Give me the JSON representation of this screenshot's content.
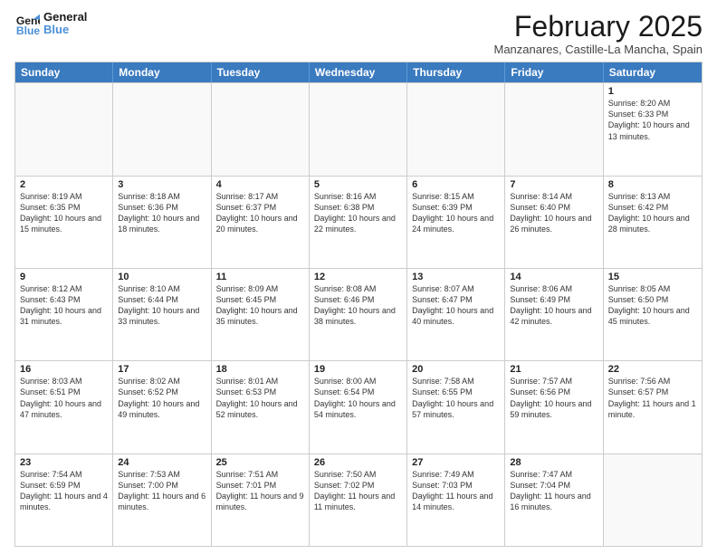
{
  "header": {
    "logo_line1": "General",
    "logo_line2": "Blue",
    "month_title": "February 2025",
    "location": "Manzanares, Castille-La Mancha, Spain"
  },
  "weekdays": [
    "Sunday",
    "Monday",
    "Tuesday",
    "Wednesday",
    "Thursday",
    "Friday",
    "Saturday"
  ],
  "weeks": [
    [
      {
        "day": "",
        "info": ""
      },
      {
        "day": "",
        "info": ""
      },
      {
        "day": "",
        "info": ""
      },
      {
        "day": "",
        "info": ""
      },
      {
        "day": "",
        "info": ""
      },
      {
        "day": "",
        "info": ""
      },
      {
        "day": "1",
        "info": "Sunrise: 8:20 AM\nSunset: 6:33 PM\nDaylight: 10 hours and 13 minutes."
      }
    ],
    [
      {
        "day": "2",
        "info": "Sunrise: 8:19 AM\nSunset: 6:35 PM\nDaylight: 10 hours and 15 minutes."
      },
      {
        "day": "3",
        "info": "Sunrise: 8:18 AM\nSunset: 6:36 PM\nDaylight: 10 hours and 18 minutes."
      },
      {
        "day": "4",
        "info": "Sunrise: 8:17 AM\nSunset: 6:37 PM\nDaylight: 10 hours and 20 minutes."
      },
      {
        "day": "5",
        "info": "Sunrise: 8:16 AM\nSunset: 6:38 PM\nDaylight: 10 hours and 22 minutes."
      },
      {
        "day": "6",
        "info": "Sunrise: 8:15 AM\nSunset: 6:39 PM\nDaylight: 10 hours and 24 minutes."
      },
      {
        "day": "7",
        "info": "Sunrise: 8:14 AM\nSunset: 6:40 PM\nDaylight: 10 hours and 26 minutes."
      },
      {
        "day": "8",
        "info": "Sunrise: 8:13 AM\nSunset: 6:42 PM\nDaylight: 10 hours and 28 minutes."
      }
    ],
    [
      {
        "day": "9",
        "info": "Sunrise: 8:12 AM\nSunset: 6:43 PM\nDaylight: 10 hours and 31 minutes."
      },
      {
        "day": "10",
        "info": "Sunrise: 8:10 AM\nSunset: 6:44 PM\nDaylight: 10 hours and 33 minutes."
      },
      {
        "day": "11",
        "info": "Sunrise: 8:09 AM\nSunset: 6:45 PM\nDaylight: 10 hours and 35 minutes."
      },
      {
        "day": "12",
        "info": "Sunrise: 8:08 AM\nSunset: 6:46 PM\nDaylight: 10 hours and 38 minutes."
      },
      {
        "day": "13",
        "info": "Sunrise: 8:07 AM\nSunset: 6:47 PM\nDaylight: 10 hours and 40 minutes."
      },
      {
        "day": "14",
        "info": "Sunrise: 8:06 AM\nSunset: 6:49 PM\nDaylight: 10 hours and 42 minutes."
      },
      {
        "day": "15",
        "info": "Sunrise: 8:05 AM\nSunset: 6:50 PM\nDaylight: 10 hours and 45 minutes."
      }
    ],
    [
      {
        "day": "16",
        "info": "Sunrise: 8:03 AM\nSunset: 6:51 PM\nDaylight: 10 hours and 47 minutes."
      },
      {
        "day": "17",
        "info": "Sunrise: 8:02 AM\nSunset: 6:52 PM\nDaylight: 10 hours and 49 minutes."
      },
      {
        "day": "18",
        "info": "Sunrise: 8:01 AM\nSunset: 6:53 PM\nDaylight: 10 hours and 52 minutes."
      },
      {
        "day": "19",
        "info": "Sunrise: 8:00 AM\nSunset: 6:54 PM\nDaylight: 10 hours and 54 minutes."
      },
      {
        "day": "20",
        "info": "Sunrise: 7:58 AM\nSunset: 6:55 PM\nDaylight: 10 hours and 57 minutes."
      },
      {
        "day": "21",
        "info": "Sunrise: 7:57 AM\nSunset: 6:56 PM\nDaylight: 10 hours and 59 minutes."
      },
      {
        "day": "22",
        "info": "Sunrise: 7:56 AM\nSunset: 6:57 PM\nDaylight: 11 hours and 1 minute."
      }
    ],
    [
      {
        "day": "23",
        "info": "Sunrise: 7:54 AM\nSunset: 6:59 PM\nDaylight: 11 hours and 4 minutes."
      },
      {
        "day": "24",
        "info": "Sunrise: 7:53 AM\nSunset: 7:00 PM\nDaylight: 11 hours and 6 minutes."
      },
      {
        "day": "25",
        "info": "Sunrise: 7:51 AM\nSunset: 7:01 PM\nDaylight: 11 hours and 9 minutes."
      },
      {
        "day": "26",
        "info": "Sunrise: 7:50 AM\nSunset: 7:02 PM\nDaylight: 11 hours and 11 minutes."
      },
      {
        "day": "27",
        "info": "Sunrise: 7:49 AM\nSunset: 7:03 PM\nDaylight: 11 hours and 14 minutes."
      },
      {
        "day": "28",
        "info": "Sunrise: 7:47 AM\nSunset: 7:04 PM\nDaylight: 11 hours and 16 minutes."
      },
      {
        "day": "",
        "info": ""
      }
    ]
  ]
}
